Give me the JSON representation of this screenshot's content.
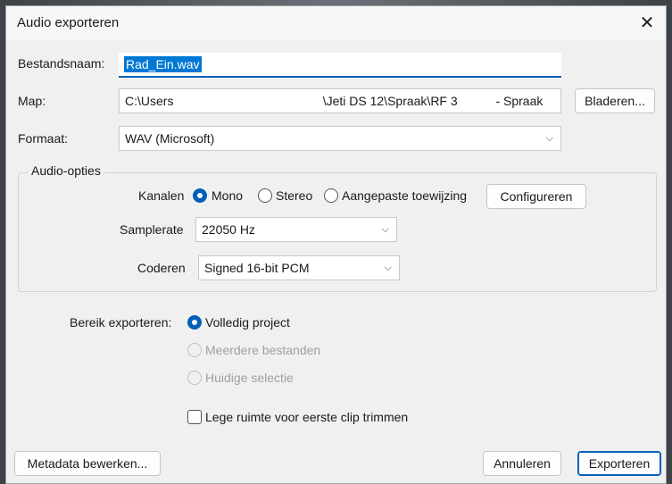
{
  "window": {
    "title": "Audio exporteren"
  },
  "form": {
    "filename_label": "Bestandsnaam:",
    "filename_value": "Rad_Ein.wav",
    "folder_label": "Map:",
    "folder_value": "C:\\Users                                           \\Jeti DS 12\\Spraak\\RF 3           - Spraak",
    "browse_button": "Bladeren...",
    "format_label": "Formaat:",
    "format_value": "WAV (Microsoft)"
  },
  "audio_options": {
    "title": "Audio-opties",
    "channels_label": "Kanalen",
    "channel_options": [
      "Mono",
      "Stereo",
      "Aangepaste toewijzing"
    ],
    "selected_channel": "Mono",
    "configure_button": "Configureren",
    "samplerate_label": "Samplerate",
    "samplerate_value": "22050 Hz",
    "encoding_label": "Coderen",
    "encoding_value": "Signed 16-bit PCM"
  },
  "export_range": {
    "label": "Bereik exporteren:",
    "options": [
      "Volledig project",
      "Meerdere bestanden",
      "Huidige selectie"
    ],
    "selected": "Volledig project",
    "trim_checkbox_label": "Lege ruimte voor eerste clip trimmen",
    "trim_checked": false
  },
  "footer": {
    "metadata_button": "Metadata bewerken...",
    "cancel_button": "Annuleren",
    "export_button": "Exporteren"
  },
  "colors": {
    "accent": "#005fb8",
    "selection": "#0078d4"
  },
  "icons": {
    "close": "close-icon",
    "dropdown": "chevron-down-icon"
  }
}
